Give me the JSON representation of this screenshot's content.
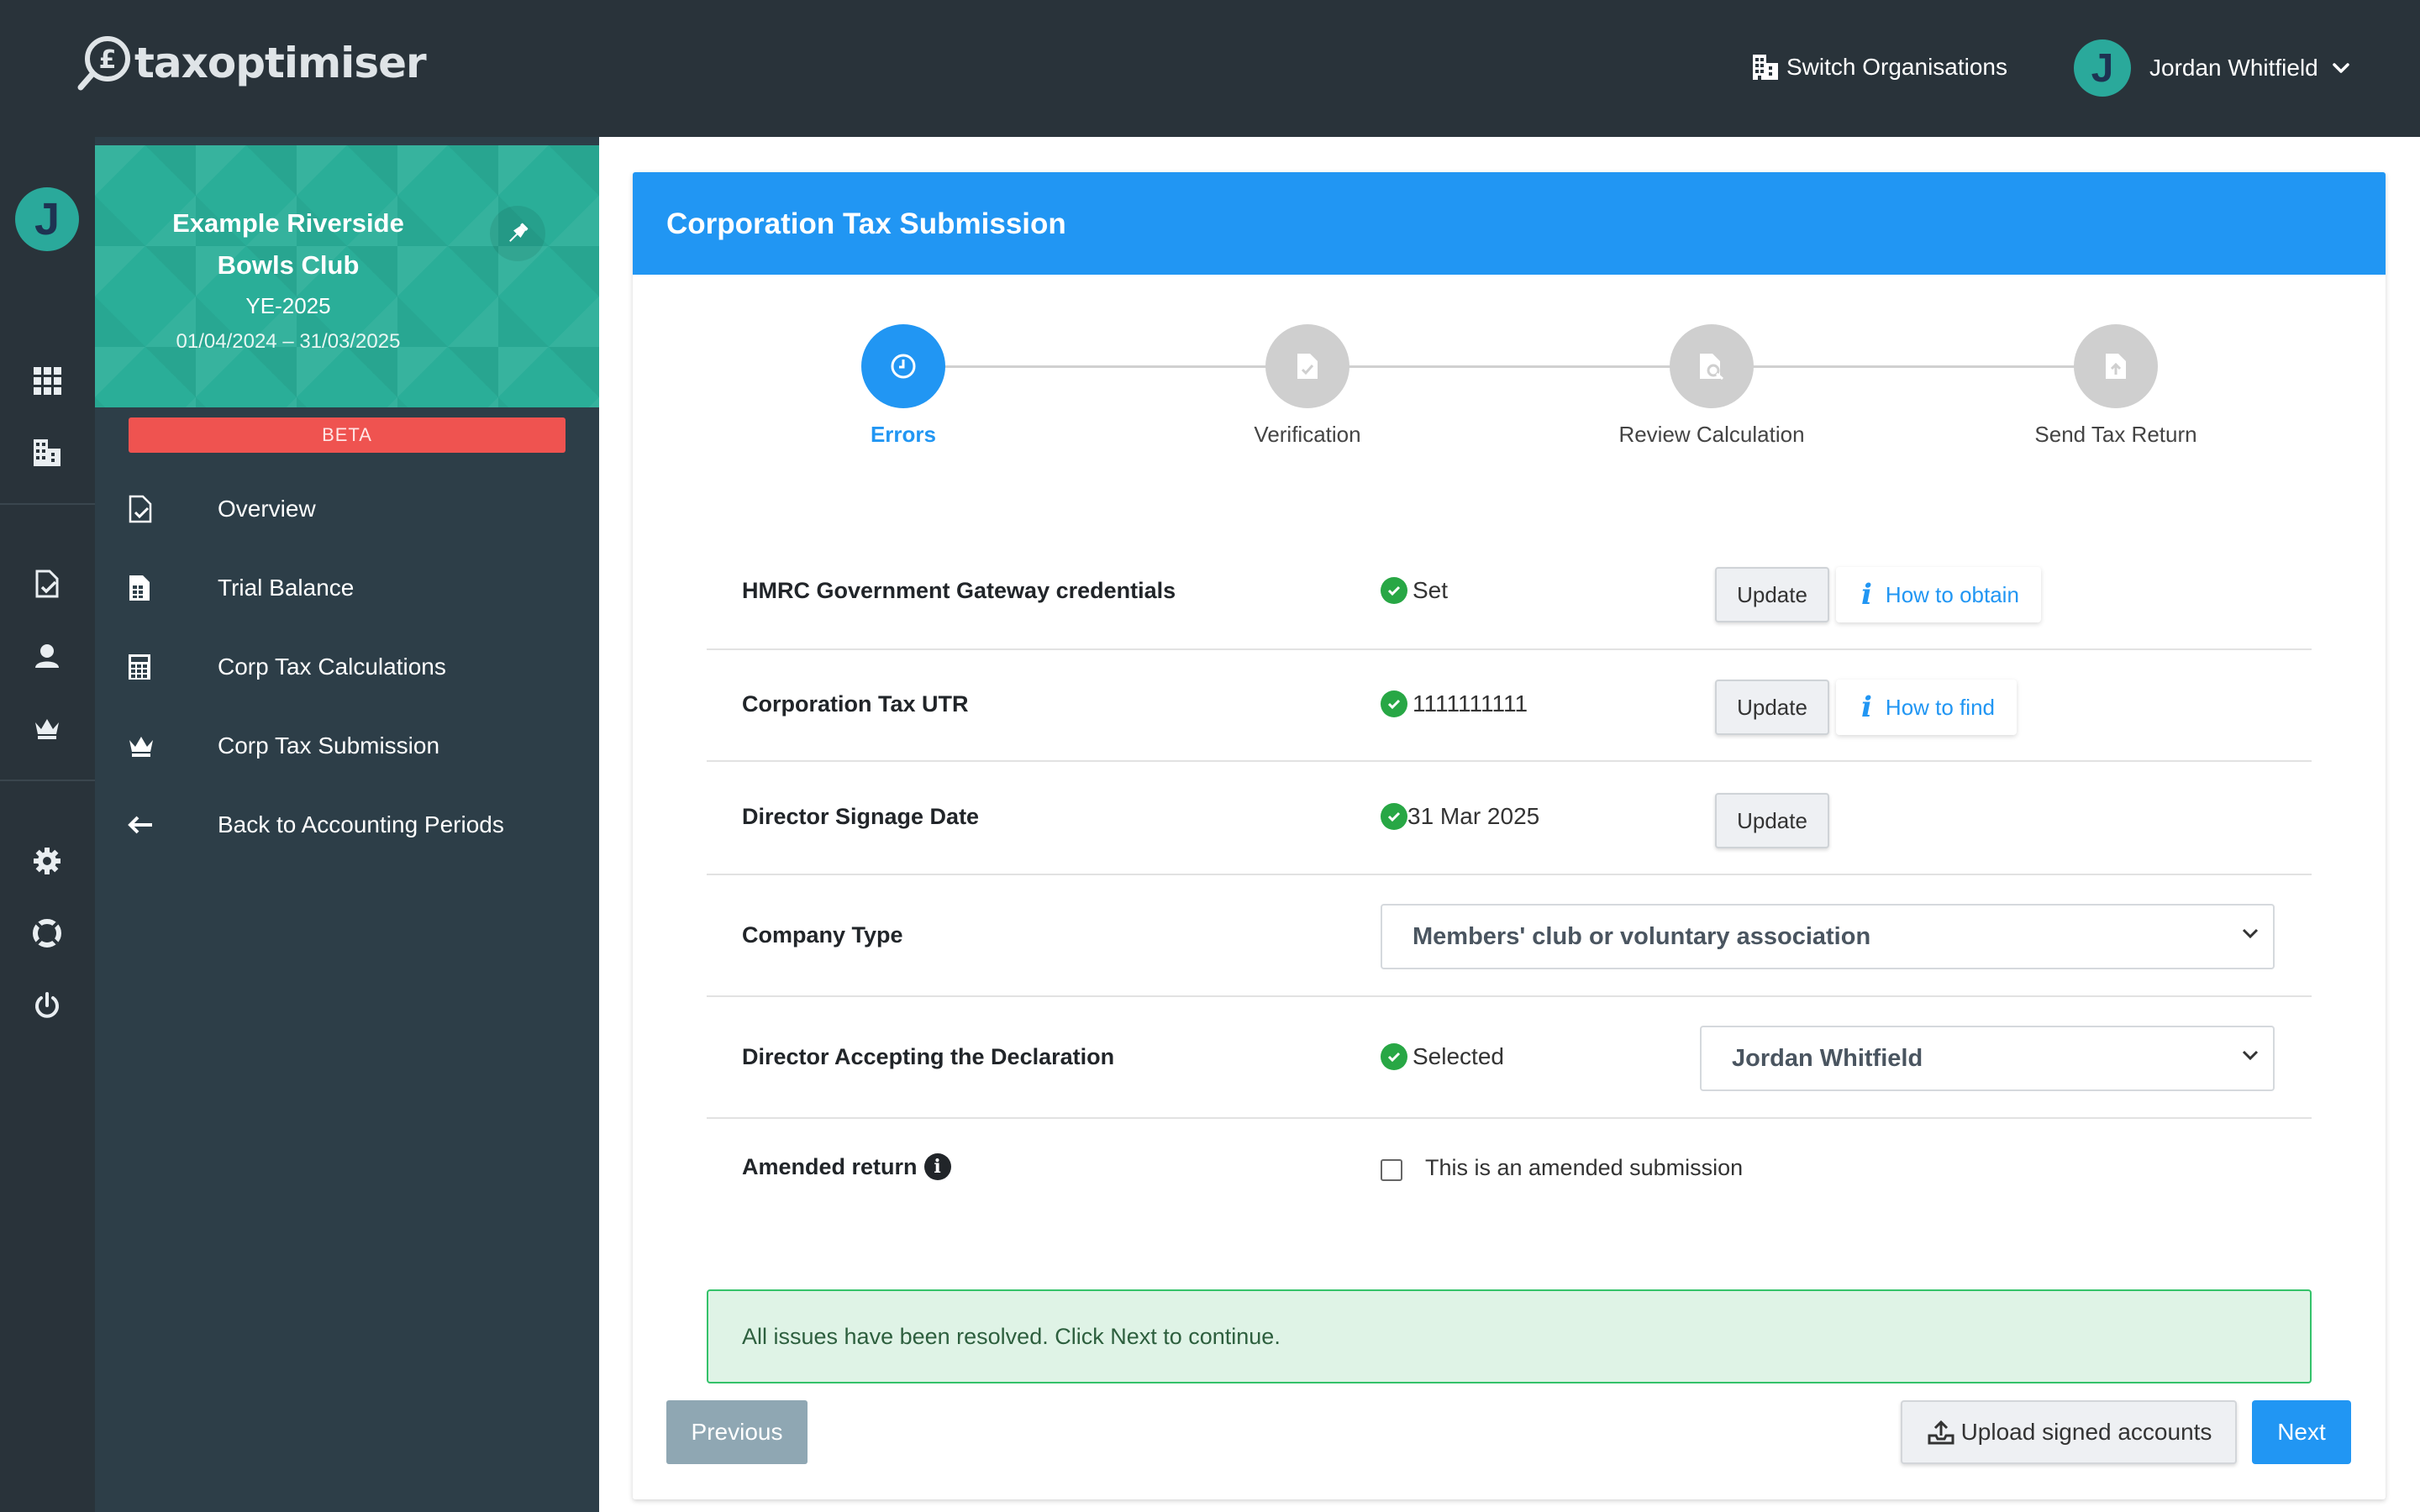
{
  "app": {
    "logo_text": "taxoptimiser"
  },
  "header": {
    "switch_org_label": "Switch Organisations",
    "user_initial": "J",
    "user_name": "Jordan Whitfield"
  },
  "rail": {
    "avatar_initial": "J"
  },
  "sidebar": {
    "org_name": "Example Riverside Bowls Club",
    "year_end": "YE-2025",
    "period": "01/04/2024 – 31/03/2025",
    "beta_label": "BETA",
    "items": [
      {
        "label": "Overview",
        "icon": "document-check-icon"
      },
      {
        "label": "Trial Balance",
        "icon": "spreadsheet-icon"
      },
      {
        "label": "Corp Tax Calculations",
        "icon": "calculator-icon"
      },
      {
        "label": "Corp Tax Submission",
        "icon": "crown-icon"
      },
      {
        "label": "Back to Accounting Periods",
        "icon": "arrow-left-icon"
      }
    ]
  },
  "main": {
    "card_title": "Corporation Tax Submission",
    "steps": [
      {
        "label": "Errors",
        "state": "active"
      },
      {
        "label": "Verification",
        "state": "inactive"
      },
      {
        "label": "Review Calculation",
        "state": "inactive"
      },
      {
        "label": "Send Tax Return",
        "state": "inactive"
      }
    ],
    "rows": {
      "gateway": {
        "label": "HMRC Government Gateway credentials",
        "status": "Set",
        "update": "Update",
        "help": "How to obtain"
      },
      "utr": {
        "label": "Corporation Tax UTR",
        "status": "1111111111",
        "update": "Update",
        "help": "How to find"
      },
      "signage": {
        "label": "Director Signage Date",
        "status": "31 Mar 2025",
        "update": "Update"
      },
      "company_type": {
        "label": "Company Type",
        "selected": "Members' club or voluntary association"
      },
      "director": {
        "label": "Director Accepting the Declaration",
        "status": "Selected",
        "selected": "Jordan Whitfield"
      },
      "amended": {
        "label": "Amended return",
        "checkbox_label": "This is an amended submission",
        "checked": false
      }
    },
    "alert": "All issues have been resolved. Click Next to continue.",
    "buttons": {
      "previous": "Previous",
      "upload": "Upload signed accounts",
      "next": "Next"
    }
  },
  "colors": {
    "topbar": "#29333a",
    "sidebar": "#2d3e48",
    "accent": "#2196f3",
    "teal": "#2aae98",
    "success": "#28a745",
    "beta": "#ef5350"
  }
}
